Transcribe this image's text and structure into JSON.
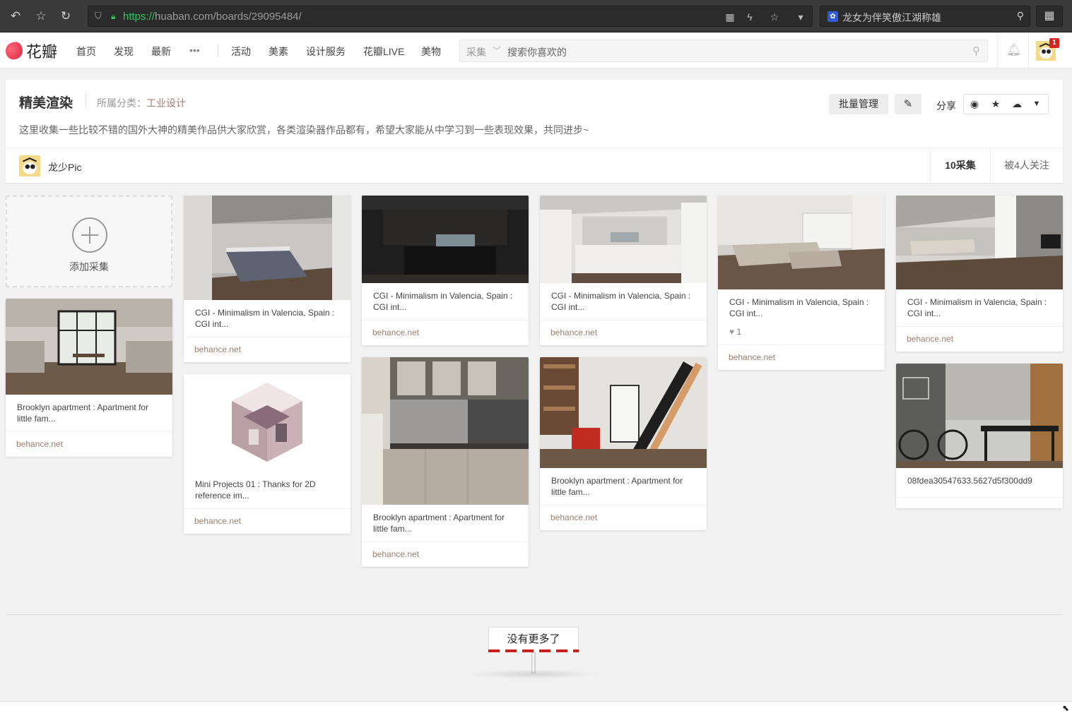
{
  "browser": {
    "url_https": "https://",
    "url_rest": "huaban.com/boards/29095484/",
    "search_text": "龙女为伴笑傲江湖称雄",
    "search_engine_icon": "paw-icon"
  },
  "site": {
    "logo_text": "花瓣",
    "nav": [
      "首页",
      "发现",
      "最新",
      "•••",
      "活动",
      "美素",
      "设计服务",
      "花瓣LIVE",
      "美物"
    ],
    "search_category": "采集",
    "search_placeholder": "搜索你喜欢的",
    "notification_count": "1"
  },
  "board": {
    "title": "精美渲染",
    "category_label": "所属分类：",
    "category": "工业设计",
    "description": "这里收集一些比较不错的国外大神的精美作品供大家欣赏，各类渲染器作品都有，希望大家能从中学习到一些表现效果，共同进步~",
    "batch_button": "批量管理",
    "share_label": "分享",
    "owner_name": "龙少Pic",
    "pins_count": "10采集",
    "followers": "被4人关注"
  },
  "add_pin_label": "添加采集",
  "pins": [
    {
      "desc": "Brooklyn apartment : Apartment for little fam...",
      "source": "behance.net"
    },
    {
      "desc": "CGI - Minimalism in Valencia, Spain : CGI int...",
      "source": "behance.net"
    },
    {
      "desc": "Mini Projects 01 : Thanks for 2D reference im...",
      "source": "behance.net"
    },
    {
      "desc": "CGI - Minimalism in Valencia, Spain : CGI int...",
      "source": "behance.net"
    },
    {
      "desc": "Brooklyn apartment : Apartment for little fam...",
      "source": "behance.net"
    },
    {
      "desc": "CGI - Minimalism in Valencia, Spain : CGI int...",
      "source": "behance.net"
    },
    {
      "desc": "Brooklyn apartment : Apartment for little fam...",
      "source": "behance.net"
    },
    {
      "desc": "CGI - Minimalism in Valencia, Spain : CGI int...",
      "likes": "1",
      "source": "behance.net"
    },
    {
      "desc": "CGI - Minimalism in Valencia, Spain : CGI int...",
      "source": "behance.net"
    },
    {
      "desc": "08fdea30547633.5627d5f300dd9"
    }
  ],
  "end_text": "没有更多了",
  "colors": {
    "accent": "#9e7e6b",
    "brand_red": "#d8243b",
    "https_green": "#38c163"
  }
}
